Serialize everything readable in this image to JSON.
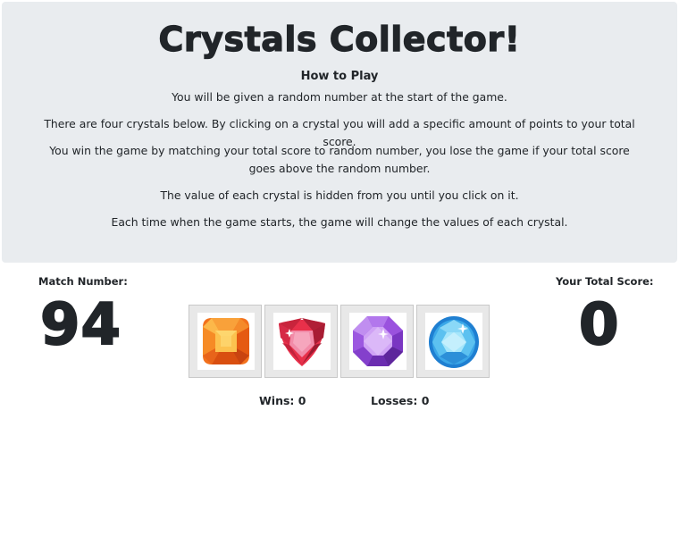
{
  "header": {
    "title": "Crystals Collector!",
    "subtitle": "How to Play",
    "instructions": [
      "You will be given a random number at the start of the game.",
      "There are four crystals below. By clicking on a crystal you will add a specific amount of points to your total score.",
      "You win the game by matching your total score to random number, you lose the game if your total score goes above the random number.",
      "The value of each crystal is hidden from you until you click on it.",
      "Each time when the game starts, the game will change the values of each crystal."
    ]
  },
  "match": {
    "label": "Match Number:",
    "value": "94"
  },
  "score": {
    "label": "Your Total Score:",
    "value": "0"
  },
  "stats": {
    "wins_label": "Wins: 0",
    "losses_label": "Losses: 0"
  },
  "crystals": [
    {
      "icon": "orange-cushion-gem-icon",
      "color": "#f28c28"
    },
    {
      "icon": "red-trillion-gem-icon",
      "color": "#e8304a"
    },
    {
      "icon": "purple-octagon-gem-icon",
      "color": "#a35ee0"
    },
    {
      "icon": "blue-round-gem-icon",
      "color": "#2f9be3"
    }
  ]
}
